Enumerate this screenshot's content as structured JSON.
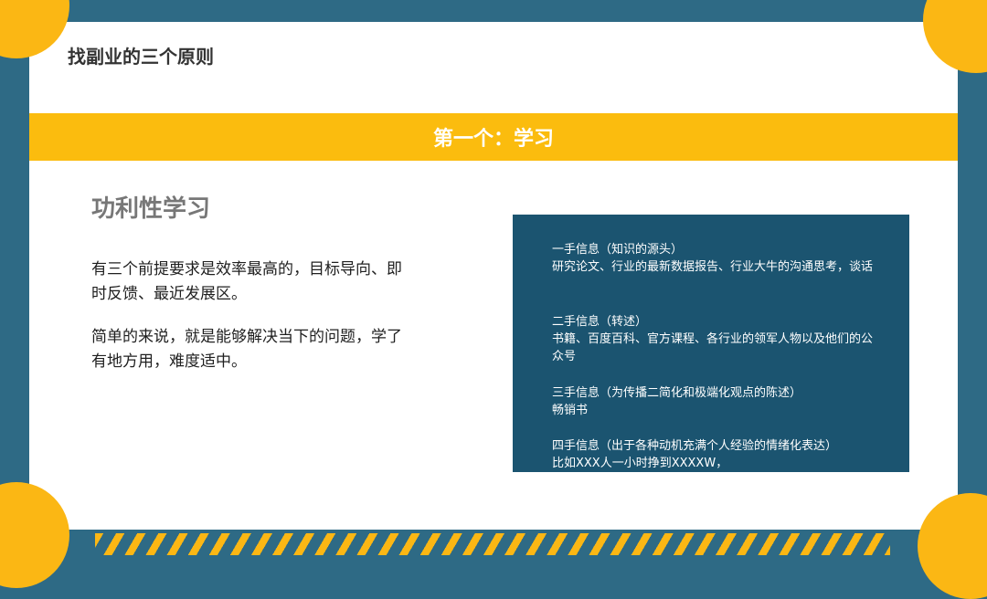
{
  "title": "找副业的三个原则",
  "banner": {
    "text": "第一个：学习"
  },
  "section": {
    "heading": "功利性学习",
    "paragraph_1": "有三个前提要求是效率最高的，目标导向、即时反馈、最近发展区。",
    "paragraph_2": "简单的来说，就是能够解决当下的问题，学了有地方用，难度适中。"
  },
  "info_box": {
    "groups": [
      {
        "head": "一手信息（知识的源头）",
        "body": "研究论文、行业的最新数据报告、行业大牛的沟通思考，谈话"
      },
      {
        "head": "二手信息（转述）",
        "body": "书籍、百度百科、官方课程、各行业的领军人物以及他们的公众号"
      },
      {
        "head": "三手信息（为传播二简化和极端化观点的陈述）",
        "body": "畅销书"
      },
      {
        "head": "四手信息（出于各种动机充满个人经验的情绪化表达）",
        "body": "比如XXX人一小时挣到XXXXW，"
      }
    ]
  },
  "colors": {
    "frame": "#2e6a85",
    "accent_yellow": "#fbbc0e",
    "box_bg": "#1b5470"
  }
}
